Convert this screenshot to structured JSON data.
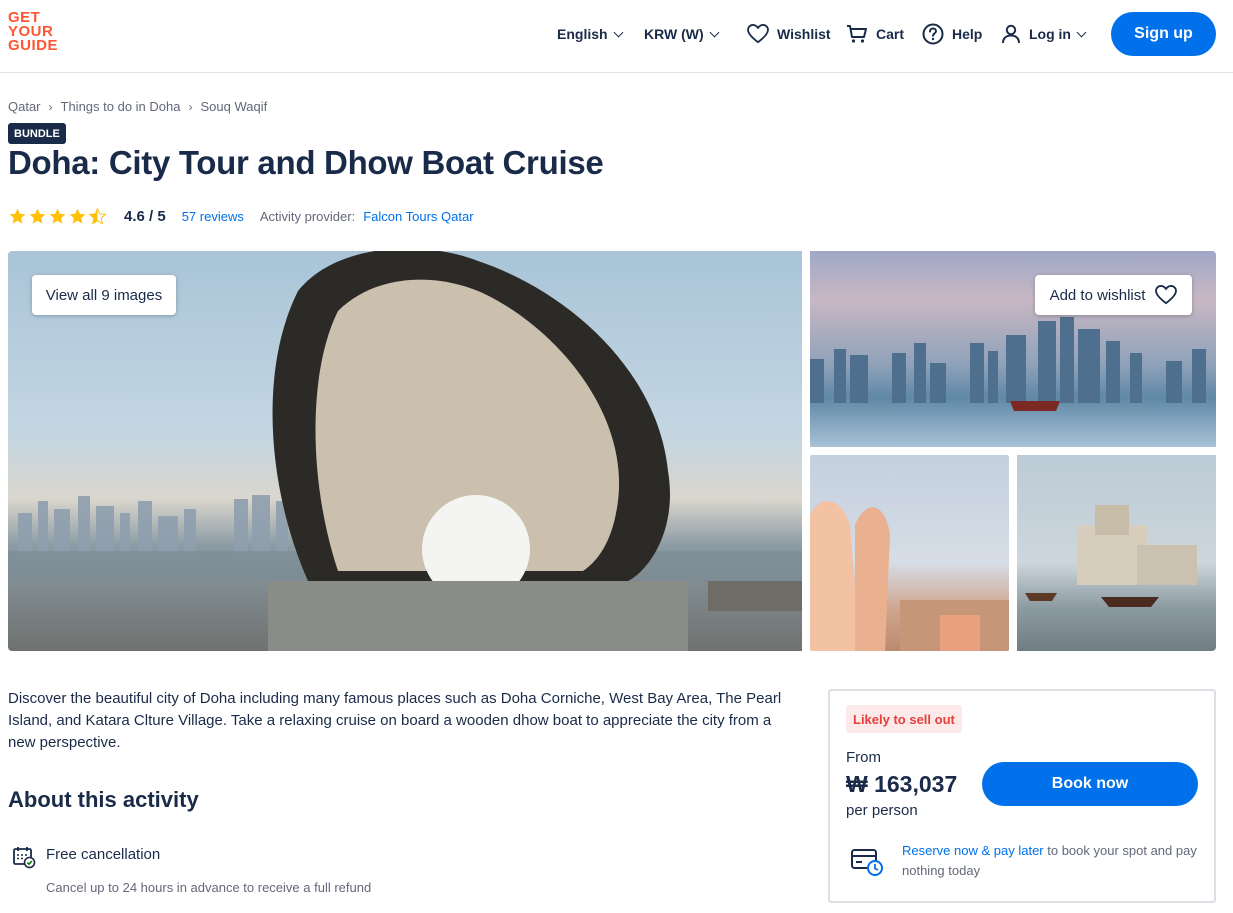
{
  "header": {
    "logo_lines": [
      "GET",
      "YOUR",
      "GUIDE"
    ],
    "language": "English",
    "currency": "KRW (W)",
    "wishlist": "Wishlist",
    "cart": "Cart",
    "help": "Help",
    "login": "Log in",
    "signup": "Sign up"
  },
  "breadcrumb": [
    "Qatar",
    "Things to do in Doha",
    "Souq Waqif"
  ],
  "badge": "BUNDLE",
  "title": "Doha: City Tour and Dhow Boat Cruise",
  "rating": {
    "value": "4.6 / 5",
    "stars_filled": 4.5,
    "reviews": "57 reviews",
    "provider_label": "Activity provider:",
    "provider": "Falcon Tours Qatar"
  },
  "gallery": {
    "view_all": "View all 9 images",
    "add_wishlist": "Add to wishlist"
  },
  "description": "Discover the beautiful city of Doha including many famous places such as Doha Corniche, West Bay Area, The Pearl Island, and Katara Clture Village. Take a relaxing cruise on board a wooden dhow boat to appreciate the city from a new perspective.",
  "about": {
    "heading": "About this activity",
    "feature_title": "Free cancellation",
    "feature_sub": "Cancel up to 24 hours in advance to receive a full refund"
  },
  "booking": {
    "badge": "Likely to sell out",
    "from": "From",
    "price": "₩ 163,037",
    "per": "per person",
    "book": "Book now",
    "reserve_link": "Reserve now & pay later",
    "reserve_rest": " to book your spot and pay nothing today"
  },
  "colors": {
    "brand": "#ff5533",
    "primary": "#0071eb",
    "text": "#1a2b49",
    "star": "#ffc107"
  }
}
